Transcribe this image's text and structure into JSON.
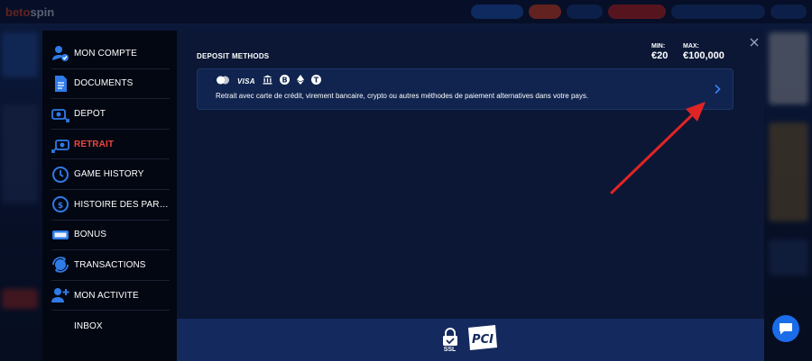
{
  "background_site": {
    "logo_prefix": "bet",
    "logo_dot": "o",
    "logo_suffix": "spin"
  },
  "sidebar": {
    "items": [
      {
        "label": "MON COMPTE",
        "icon": "user-check-icon",
        "active": false
      },
      {
        "label": "DOCUMENTS",
        "icon": "document-icon",
        "active": false
      },
      {
        "label": "DÉPÔT",
        "icon": "deposit-icon",
        "active": false
      },
      {
        "label": "RETRAIT",
        "icon": "withdraw-icon",
        "active": true
      },
      {
        "label": "GAME HISTORY",
        "icon": "history-icon",
        "active": false
      },
      {
        "label": "HISTOIRE DES PARIS S...",
        "icon": "bet-history-icon",
        "active": false
      },
      {
        "label": "BONUS",
        "icon": "free-badge-icon",
        "active": false
      },
      {
        "label": "TRANSACTIONS",
        "icon": "transactions-icon",
        "active": false
      },
      {
        "label": "MON ACTIVITÉ",
        "icon": "user-activity-icon",
        "active": false
      },
      {
        "label": "INBOX",
        "icon": "",
        "active": false
      }
    ]
  },
  "main": {
    "section_title": "DEPOSIT METHODS",
    "min_label": "MIN:",
    "min_value": "€20",
    "max_label": "MAX:",
    "max_value": "€100,000",
    "method": {
      "visa_label": "VISA",
      "description": "Retrait avec carte de crédit, virement bancaire, crypto ou autres méthodes de paiement alternatives dans votre pays."
    }
  },
  "footer": {
    "ssl_label": "SSL",
    "pci_label": "PCI"
  },
  "colors": {
    "active": "#f0453f",
    "accent_blue": "#2f7be8",
    "annotation_arrow": "#e02424"
  }
}
